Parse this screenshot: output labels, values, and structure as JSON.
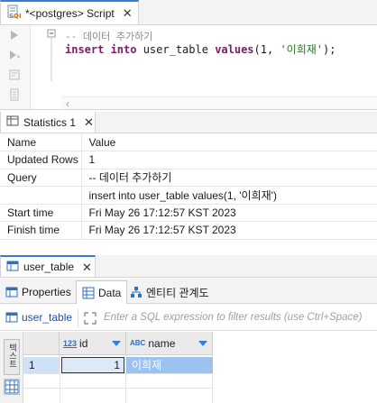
{
  "editor": {
    "tab_title": "*<postgres> Script",
    "code_comment": "-- 데이터 추가하기",
    "code_insert_kw": "insert into",
    "code_table": " user_table ",
    "code_values_kw": "values",
    "code_args_start": "(1, ",
    "code_string": "'이희재'",
    "code_args_end": ");"
  },
  "statistics": {
    "tab_title": "Statistics 1",
    "columns": [
      "Name",
      "Value"
    ],
    "rows": [
      {
        "name": "Updated Rows",
        "value": "1"
      },
      {
        "name": "Query",
        "value": "-- 데이터 추가하기"
      },
      {
        "name": "",
        "value": "insert into user_table values(1, '이희재')"
      },
      {
        "name": "Start time",
        "value": "Fri May 26 17:12:57 KST 2023"
      },
      {
        "name": "Finish time",
        "value": "Fri May 26 17:12:57 KST 2023"
      }
    ]
  },
  "results": {
    "tab_title": "user_table",
    "subtabs": [
      "Properties",
      "Data",
      "엔티티 관계도"
    ],
    "filter": {
      "table_name": "user_table",
      "placeholder": "Enter a SQL expression to filter results (use Ctrl+Space)"
    },
    "side_text_button": "텍스트",
    "grid": {
      "columns": [
        {
          "name": "id",
          "type_badge": "123"
        },
        {
          "name": "name",
          "type_badge": "ABC"
        }
      ],
      "rows": [
        {
          "num": "1",
          "id": "1",
          "name": "이희재"
        }
      ]
    }
  },
  "colors": {
    "accent": "#3a7bd5",
    "selected_row": "#9cc3ef"
  }
}
